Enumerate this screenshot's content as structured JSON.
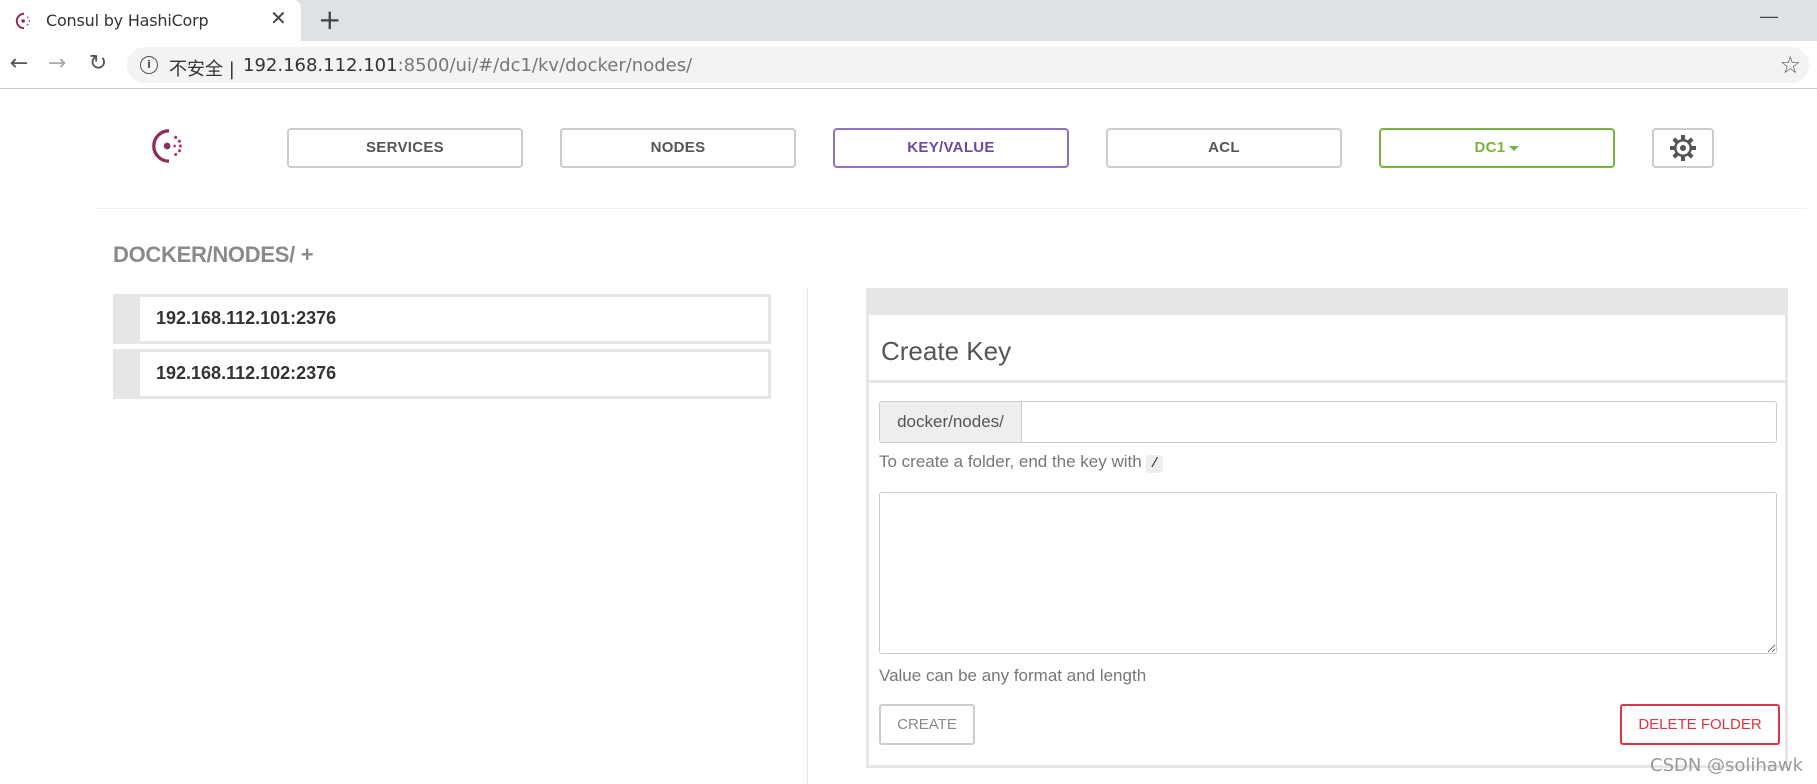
{
  "browser": {
    "tab_title": "Consul by HashiCorp",
    "insecure_label": "不安全 |",
    "url_host": "192.168.112.101",
    "url_rest": ":8500/ui/#/dc1/kv/docker/nodes/"
  },
  "nav": {
    "services": "SERVICES",
    "nodes": "NODES",
    "keyvalue": "KEY/VALUE",
    "acl": "ACL",
    "dc": "DC1"
  },
  "kv": {
    "breadcrumb": "DOCKER/NODES/ +",
    "items": [
      {
        "label": "192.168.112.101:2376"
      },
      {
        "label": "192.168.112.102:2376"
      }
    ]
  },
  "create_key": {
    "title": "Create Key",
    "prefix": "docker/nodes/",
    "key_value": "",
    "hint_text": "To create a folder, end the key with",
    "hint_code": "/",
    "value_text": "",
    "value_hint": "Value can be any format and length",
    "create_label": "CREATE",
    "delete_label": "DELETE FOLDER"
  },
  "colors": {
    "active_nav": "#694a9c",
    "dc_green": "#7ab23f",
    "danger": "#dc3545",
    "consul_logo": "#8e2c5c"
  },
  "watermark": "CSDN @solihawk"
}
